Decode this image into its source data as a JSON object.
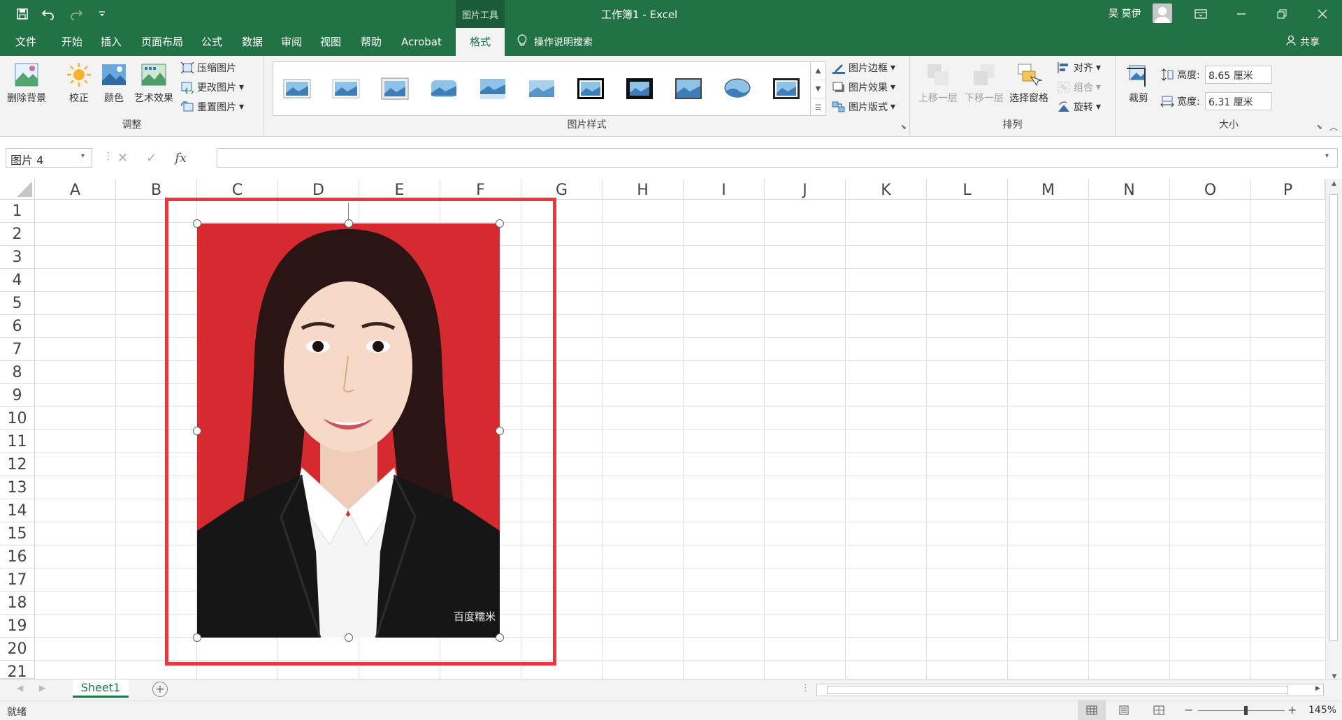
{
  "app": {
    "title": "工作簿1 - Excel",
    "context_tools": "图片工具",
    "user": "吴 莫伊"
  },
  "tabs": [
    {
      "label": "文件"
    },
    {
      "label": "开始"
    },
    {
      "label": "插入"
    },
    {
      "label": "页面布局"
    },
    {
      "label": "公式"
    },
    {
      "label": "数据"
    },
    {
      "label": "审阅"
    },
    {
      "label": "视图"
    },
    {
      "label": "帮助"
    },
    {
      "label": "Acrobat"
    },
    {
      "label": "格式",
      "active": true
    }
  ],
  "tell_me": "操作说明搜索",
  "share": "共享",
  "ribbon": {
    "adjust": {
      "label": "调整",
      "remove_bg": "删除背景",
      "correct": "校正",
      "color": "颜色",
      "artistic": "艺术效果",
      "compress": "压缩图片",
      "change": "更改图片",
      "reset": "重置图片"
    },
    "styles": {
      "label": "图片样式",
      "border": "图片边框",
      "effects": "图片效果",
      "layout": "图片版式"
    },
    "arrange": {
      "label": "排列",
      "bring_forward": "上移一层",
      "send_backward": "下移一层",
      "selection_pane": "选择窗格",
      "align": "对齐",
      "group": "组合",
      "rotate": "旋转"
    },
    "size": {
      "label": "大小",
      "crop": "裁剪",
      "height_label": "高度:",
      "height_value": "8.65 厘米",
      "width_label": "宽度:",
      "width_value": "6.31 厘米"
    }
  },
  "formula_bar": {
    "name_box": "图片 4",
    "fx": "fx",
    "value": ""
  },
  "columns": [
    "A",
    "B",
    "C",
    "D",
    "E",
    "F",
    "G",
    "H",
    "I",
    "J",
    "K",
    "L",
    "M",
    "N",
    "O",
    "P"
  ],
  "rows": [
    "1",
    "2",
    "3",
    "4",
    "5",
    "6",
    "7",
    "8",
    "9",
    "10",
    "11",
    "12",
    "13",
    "14",
    "15",
    "16",
    "17",
    "18",
    "19",
    "20",
    "21"
  ],
  "picture": {
    "watermark": "百度糯米"
  },
  "sheet_tabs": [
    "Sheet1"
  ],
  "status": {
    "ready": "就绪",
    "zoom": "145%"
  },
  "colors": {
    "excel_green": "#217346",
    "highlight_red": "#e8383d",
    "photo_bg_red": "#d42a30"
  }
}
